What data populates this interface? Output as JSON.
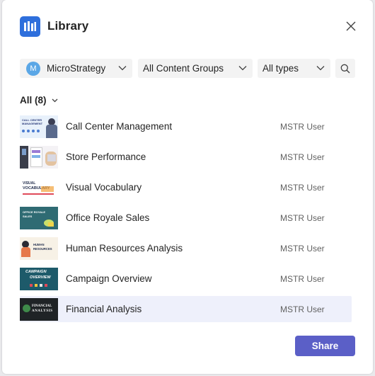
{
  "header": {
    "title": "Library",
    "app_icon": "library-icon",
    "close_icon": "close-icon"
  },
  "filters": {
    "app": {
      "avatar_letter": "M",
      "value": "MicroStrategy"
    },
    "content_groups": {
      "value": "All Content Groups"
    },
    "types": {
      "value": "All types"
    },
    "search_icon": "search-icon"
  },
  "list": {
    "filter_label": "All (8)",
    "items": [
      {
        "name": "Call Center Management",
        "owner": "MSTR User",
        "thumb_text": [
          "CALL CENTER",
          "MANAGEMENT"
        ]
      },
      {
        "name": "Store Performance",
        "owner": "MSTR User"
      },
      {
        "name": "Visual Vocabulary",
        "owner": "MSTR User",
        "thumb_text": [
          "VISUAL",
          "VOCABULARY"
        ]
      },
      {
        "name": "Office Royale Sales",
        "owner": "MSTR User",
        "thumb_text": [
          "OFFICE ROYALE",
          "SALES"
        ]
      },
      {
        "name": "Human Resources Analysis",
        "owner": "MSTR User",
        "thumb_text": [
          "HUMAN",
          "RESOURCES"
        ]
      },
      {
        "name": "Campaign Overview",
        "owner": "MSTR User",
        "thumb_text": [
          "CAMPAIGN",
          "OVERVIEW"
        ]
      },
      {
        "name": "Financial Analysis",
        "owner": "MSTR User",
        "thumb_text": [
          "FINANCIAL",
          "ANALYSIS"
        ]
      }
    ],
    "selected_index": 6
  },
  "footer": {
    "share_label": "Share"
  },
  "colors": {
    "accent": "#5b5fc7",
    "app_icon_bg": "#2e6fdc",
    "selected_row_bg": "#eef0fb",
    "field_bg": "#f3f3f3",
    "avatar_bg": "#5ba7e6"
  }
}
